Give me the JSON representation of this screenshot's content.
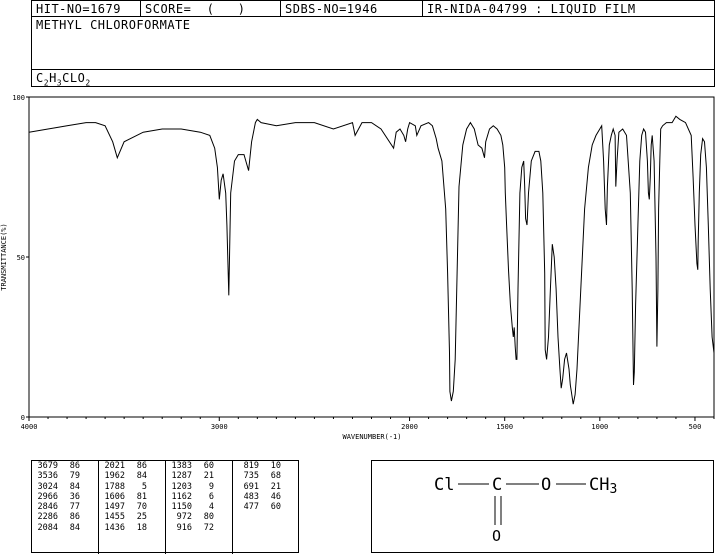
{
  "header": {
    "hit_no": "HIT-NO=1679",
    "score": "SCORE=  (   )",
    "sdbs_no": "SDBS-NO=1946",
    "ir": "IR-NIDA-04799 : LIQUID FILM",
    "compound": "METHYL CHLOROFORMATE",
    "formula": {
      "c": "C",
      "c_n": "2",
      "h": "H",
      "h_n": "3",
      "rest": "CLO",
      "o_n": "2"
    }
  },
  "chart_data": {
    "type": "line",
    "xlabel": "WAVENUMBER(-1)",
    "ylabel": "TRANSMITTANCE(%)",
    "xlim": [
      4000,
      400
    ],
    "ylim": [
      0,
      100
    ],
    "xticks": [
      4000,
      3000,
      2000,
      1500,
      1000,
      500
    ],
    "yticks": [
      0,
      50,
      100
    ],
    "series": [
      {
        "x": [
          4000,
          3900,
          3800,
          3700,
          3650,
          3600,
          3560,
          3536,
          3500,
          3400,
          3300,
          3200,
          3100,
          3050,
          3024,
          3010,
          3000,
          2990,
          2980,
          2966,
          2960,
          2950,
          2940,
          2920,
          2900,
          2870,
          2846,
          2830,
          2810,
          2800,
          2780,
          2700,
          2600,
          2500,
          2400,
          2300,
          2286,
          2250,
          2200,
          2150,
          2084,
          2070,
          2050,
          2030,
          2021,
          2010,
          2000,
          1970,
          1962,
          1940,
          1900,
          1880,
          1860,
          1850,
          1830,
          1810,
          1800,
          1790,
          1788,
          1780,
          1770,
          1760,
          1750,
          1740,
          1720,
          1700,
          1680,
          1660,
          1640,
          1620,
          1606,
          1600,
          1580,
          1560,
          1540,
          1520,
          1510,
          1500,
          1497,
          1490,
          1480,
          1470,
          1460,
          1455,
          1450,
          1445,
          1440,
          1436,
          1430,
          1420,
          1410,
          1400,
          1395,
          1390,
          1383,
          1375,
          1360,
          1340,
          1320,
          1310,
          1300,
          1290,
          1287,
          1280,
          1270,
          1260,
          1250,
          1240,
          1230,
          1220,
          1210,
          1203,
          1195,
          1185,
          1175,
          1162,
          1155,
          1150,
          1140,
          1130,
          1120,
          1100,
          1080,
          1060,
          1040,
          1020,
          1000,
          990,
          980,
          972,
          965,
          960,
          950,
          940,
          930,
          920,
          916,
          910,
          900,
          880,
          860,
          840,
          830,
          823,
          819,
          812,
          800,
          790,
          780,
          770,
          760,
          750,
          745,
          740,
          735,
          730,
          725,
          715,
          705,
          700,
          695,
          691,
          685,
          680,
          670,
          650,
          620,
          600,
          580,
          550,
          520,
          510,
          500,
          490,
          485,
          483,
          480,
          477,
          470,
          460,
          450,
          440,
          430,
          420,
          410,
          400
        ],
        "y": [
          89,
          90,
          91,
          92,
          92,
          91,
          86,
          81,
          86,
          89,
          90,
          90,
          89,
          88,
          84,
          78,
          68,
          74,
          76,
          70,
          60,
          38,
          70,
          80,
          82,
          82,
          77,
          86,
          92,
          93,
          92,
          91,
          92,
          92,
          90,
          92,
          88,
          92,
          92,
          90,
          84,
          89,
          90,
          88,
          86,
          90,
          92,
          91,
          88,
          91,
          92,
          91,
          87,
          84,
          80,
          65,
          45,
          20,
          8,
          5,
          8,
          18,
          45,
          72,
          85,
          90,
          92,
          90,
          85,
          84,
          81,
          86,
          90,
          91,
          90,
          88,
          85,
          78,
          70,
          60,
          46,
          35,
          28,
          25,
          28,
          22,
          18,
          18,
          40,
          70,
          78,
          80,
          72,
          62,
          60,
          70,
          80,
          83,
          83,
          80,
          70,
          45,
          21,
          18,
          25,
          40,
          54,
          50,
          40,
          25,
          15,
          9,
          12,
          18,
          20,
          15,
          10,
          8,
          4,
          7,
          15,
          40,
          65,
          78,
          85,
          88,
          90,
          91,
          80,
          65,
          60,
          72,
          85,
          88,
          90,
          88,
          72,
          80,
          89,
          90,
          88,
          70,
          40,
          10,
          14,
          35,
          60,
          80,
          88,
          90,
          89,
          80,
          70,
          68,
          75,
          85,
          88,
          80,
          50,
          22,
          40,
          65,
          80,
          90,
          91,
          92,
          92,
          94,
          93,
          92,
          88,
          75,
          60,
          48,
          46,
          55,
          63,
          70,
          82,
          87,
          86,
          78,
          60,
          40,
          25,
          20
        ]
      }
    ],
    "peak_table": [
      [
        "3679",
        "86"
      ],
      [
        "3536",
        "79"
      ],
      [
        "3024",
        "84"
      ],
      [
        "2966",
        "36"
      ],
      [
        "2846",
        "77"
      ],
      [
        "2286",
        "86"
      ],
      [
        "2084",
        "84"
      ],
      [
        "2021",
        "86"
      ],
      [
        "1962",
        "84"
      ],
      [
        "1788",
        "5"
      ],
      [
        "1606",
        "81"
      ],
      [
        "1497",
        "70"
      ],
      [
        "1455",
        "25"
      ],
      [
        "1436",
        "18"
      ],
      [
        "1383",
        "60"
      ],
      [
        "1287",
        "21"
      ],
      [
        "1203",
        "9"
      ],
      [
        "1162",
        "6"
      ],
      [
        "1150",
        "4"
      ],
      [
        "972",
        "80"
      ],
      [
        "916",
        "72"
      ],
      [
        "819",
        "10"
      ],
      [
        "735",
        "68"
      ],
      [
        "691",
        "21"
      ],
      [
        "483",
        "46"
      ],
      [
        "477",
        "60"
      ]
    ]
  },
  "structure": {
    "cl": "Cl",
    "c": "C",
    "o": "O",
    "ch3": "CH",
    "ch3_sub": "3",
    "o_double": "O"
  }
}
